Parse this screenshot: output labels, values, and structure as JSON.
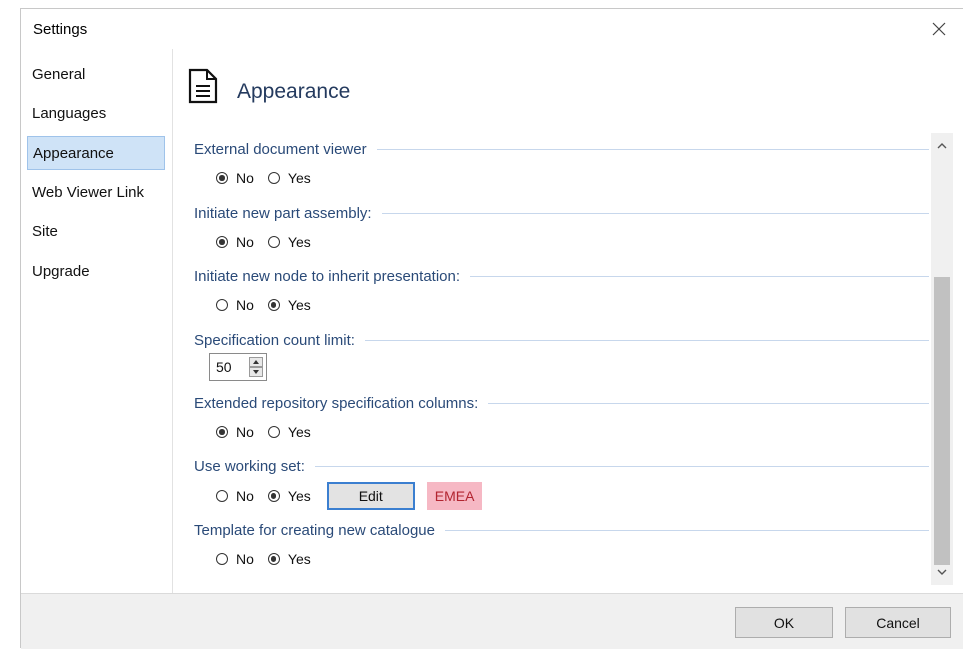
{
  "window": {
    "title": "Settings",
    "close_icon": "close-icon"
  },
  "sidebar": {
    "items": [
      {
        "label": "General",
        "selected": false
      },
      {
        "label": "Languages",
        "selected": false
      },
      {
        "label": "Appearance",
        "selected": true
      },
      {
        "label": "Web Viewer Link",
        "selected": false
      },
      {
        "label": "Site",
        "selected": false
      },
      {
        "label": "Upgrade",
        "selected": false
      }
    ]
  },
  "header": {
    "icon": "document-icon",
    "title": "Appearance"
  },
  "settings": {
    "external_viewer": {
      "label": "External document viewer",
      "options": [
        "No",
        "Yes"
      ],
      "selected": "No"
    },
    "part_assembly": {
      "label": "Initiate new part assembly:",
      "options": [
        "No",
        "Yes"
      ],
      "selected": "No"
    },
    "inherit_presentation": {
      "label": "Initiate new node to inherit presentation:",
      "options": [
        "No",
        "Yes"
      ],
      "selected": "Yes"
    },
    "spec_count_limit": {
      "label": "Specification count limit:",
      "value": "50"
    },
    "extended_columns": {
      "label": "Extended repository specification columns:",
      "options": [
        "No",
        "Yes"
      ],
      "selected": "No"
    },
    "working_set": {
      "label": "Use working set:",
      "options": [
        "No",
        "Yes"
      ],
      "selected": "Yes",
      "edit_label": "Edit",
      "badge": "EMEA"
    },
    "catalogue_template": {
      "label": "Template for creating new catalogue",
      "options": [
        "No",
        "Yes"
      ],
      "selected": "Yes"
    }
  },
  "footer": {
    "ok_label": "OK",
    "cancel_label": "Cancel"
  },
  "colors": {
    "selection_bg": "#cfe3f7",
    "section_label": "#2a4a78",
    "badge_bg": "#f6b8c4",
    "badge_text": "#b22430",
    "edit_border": "#3b7fd0"
  }
}
